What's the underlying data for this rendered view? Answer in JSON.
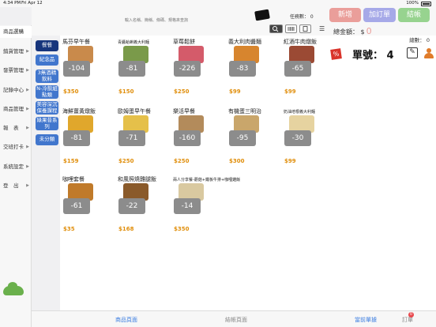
{
  "status": {
    "time": "4:34 PM",
    "date": "Fri Apr 12",
    "battery": "100%"
  },
  "header": {
    "search_placeholder": "輸入名稱、簡稱、條碼、規格來查詢",
    "task_count": "任務數： 0",
    "new_label": "新增",
    "add_order_label": "加訂單",
    "checkout_label": "結帳",
    "menu_glyph": "☰",
    "total_label": "總金額： $",
    "total_amount": "0"
  },
  "sidebar": {
    "items": [
      {
        "label": "商品選購",
        "chev": ""
      },
      {
        "label": "銷貨管理",
        "chev": "▶"
      },
      {
        "label": "發票管理",
        "chev": "▶"
      },
      {
        "label": "記錄中心",
        "chev": "▶"
      },
      {
        "label": "商品管理",
        "chev": "▶"
      },
      {
        "label": "報　表",
        "chev": "▶"
      },
      {
        "label": "交班打卡",
        "chev": "▶"
      },
      {
        "label": "系統設定",
        "chev": "▶"
      },
      {
        "label": "登　出",
        "chev": "▶"
      }
    ]
  },
  "categories": [
    "餐餐",
    "紀念品",
    "3無酒精飲料",
    "N-冷飲組點類",
    "美容深沉保養課程",
    "綠果昔系列",
    "未分類"
  ],
  "products": [
    {
      "name": "馬芬早午餐",
      "stock": "-104",
      "price": "$350",
      "small": false,
      "color": "#c98a4b"
    },
    {
      "name": "青醬蛤蜊義大利麵",
      "stock": "-81",
      "price": "$150",
      "small": true,
      "color": "#7a9a4a"
    },
    {
      "name": "草莓鬆餅",
      "stock": "-226",
      "price": "$250",
      "small": false,
      "color": "#d45b6a"
    },
    {
      "name": "義大利肉醬麵",
      "stock": "-83",
      "price": "$99",
      "small": false,
      "color": "#d7852e"
    },
    {
      "name": "紅酒牛肉燉飯",
      "stock": "-65",
      "price": "$99",
      "small": false,
      "color": "#9b4a34"
    },
    {
      "name": "海鮮薑黃燉飯",
      "stock": "-81",
      "price": "$159",
      "small": false,
      "color": "#e0a72c"
    },
    {
      "name": "歐姆蛋早午餐",
      "stock": "-71",
      "price": "$250",
      "small": false,
      "color": "#e5c04a"
    },
    {
      "name": "樂活早餐",
      "stock": "-160",
      "price": "$250",
      "small": false,
      "color": "#b38b5b"
    },
    {
      "name": "有機蛋三明治",
      "stock": "-95",
      "price": "$300",
      "small": false,
      "color": "#c9a66b"
    },
    {
      "name": "奶油培根義大利麵",
      "stock": "-30",
      "price": "$99",
      "small": true,
      "color": "#e6d3a0"
    },
    {
      "name": "咖哩套餐",
      "stock": "-61",
      "price": "$35",
      "small": false,
      "color": "#c07a2a"
    },
    {
      "name": "和風照燒雞腿飯",
      "stock": "-22",
      "price": "$168",
      "small": false,
      "color": "#8a5a2a"
    },
    {
      "name": "兩人分享餐-蘑菇+鐵板牛排+咖哩雞飯",
      "stock": "-14",
      "price": "$350",
      "small": true,
      "color": "#d9c9a0"
    }
  ],
  "panel": {
    "count": "總數： 0",
    "pct_icon": "%",
    "order_label": "單號：",
    "order_number": "4"
  },
  "tabs": {
    "goods_page": "商品頁面",
    "checkout_page": "結帳頁面",
    "current_order": "當前單據",
    "orders": "訂單",
    "orders_badge": "0"
  }
}
